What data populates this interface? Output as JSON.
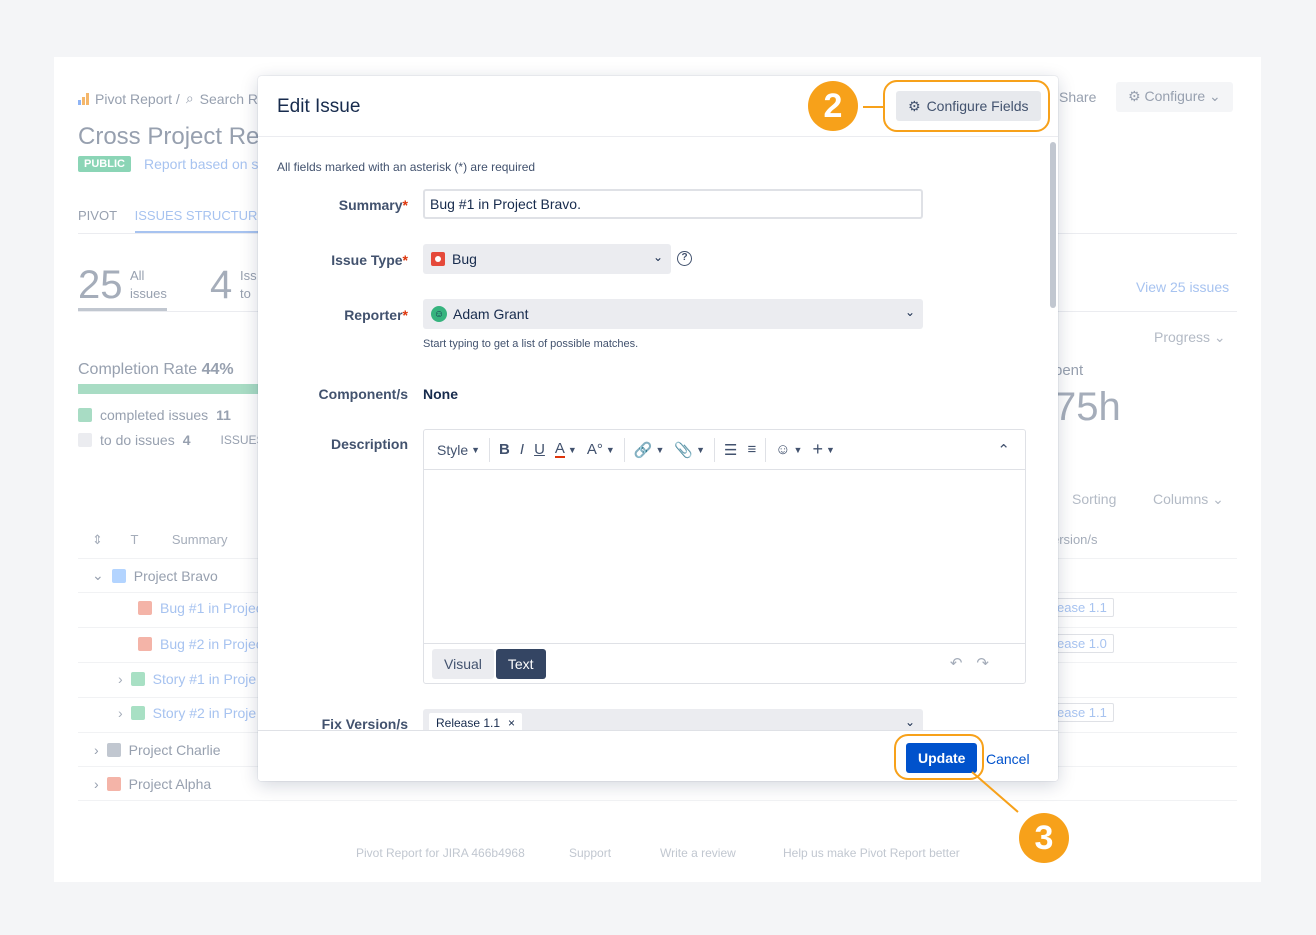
{
  "background": {
    "breadcrumb": {
      "pivot": "Pivot Report /",
      "search": "Search R"
    },
    "title": "Cross Project Rep",
    "badge": "PUBLIC",
    "subtitle": "Report based on se",
    "share": "Share",
    "configure": "Configure",
    "tabs": [
      "PIVOT",
      "ISSUES STRUCTURE"
    ],
    "stats": {
      "total": "25",
      "total_label1": "All",
      "total_label2": "issues",
      "second": "4",
      "second_label1": "Iss",
      "second_label2": "to"
    },
    "view_link": "View 25 issues",
    "progress": "Progress",
    "spent_label": "pent",
    "spent_value": "75h",
    "completion": {
      "label": "Completion Rate",
      "value": "44%",
      "completed_label": "completed issues",
      "completed_count": "11",
      "todo_label": "to do issues",
      "todo_count": "4",
      "issues_tag": "ISSUES"
    },
    "sorting": "Sorting",
    "columns": "Columns",
    "table_headers": {
      "t": "T",
      "summary": "Summary",
      "version": "ersion/s"
    },
    "rows": [
      {
        "label": "Project Bravo",
        "indent": 0,
        "expand": "v",
        "color": "#b3d4ff"
      },
      {
        "label": "Bug #1 in Projec",
        "indent": 2,
        "expand": "",
        "color": "#f4b4a8",
        "release": "ease 1.1"
      },
      {
        "label": "Bug #2 in Projec",
        "indent": 2,
        "expand": "",
        "color": "#f4b4a8",
        "release": "ease 1.0"
      },
      {
        "label": "Story #1 in Proje",
        "indent": 1,
        "expand": ">",
        "color": "#a8e0c4"
      },
      {
        "label": "Story #2 in Proje",
        "indent": 1,
        "expand": ">",
        "color": "#a8e0c4",
        "release": "ease 1.1"
      },
      {
        "label": "Project Charlie",
        "indent": 0,
        "expand": ">",
        "color": "#c1c7d0"
      },
      {
        "label": "Project Alpha",
        "indent": 0,
        "expand": ">",
        "color": "#f4b4a8"
      }
    ],
    "footer": [
      "Pivot Report for JIRA 466b4968",
      "Support",
      "Write a review",
      "Help us make Pivot Report better"
    ]
  },
  "modal": {
    "title": "Edit Issue",
    "configure_fields": "Configure Fields",
    "required_note": "All fields marked with an asterisk (*) are required",
    "summary": {
      "label": "Summary",
      "value": "Bug #1 in Project Bravo."
    },
    "issue_type": {
      "label": "Issue Type",
      "value": "Bug"
    },
    "reporter": {
      "label": "Reporter",
      "value": "Adam Grant",
      "hint": "Start typing to get a list of possible matches."
    },
    "components": {
      "label": "Component/s",
      "value": "None"
    },
    "description": {
      "label": "Description",
      "style_label": "Style",
      "mode_visual": "Visual",
      "mode_text": "Text"
    },
    "fix_version": {
      "label": "Fix Version/s",
      "chip": "Release 1.1"
    },
    "update": "Update",
    "cancel": "Cancel"
  },
  "callouts": [
    "2",
    "3"
  ],
  "colors": {
    "accent": "#f7a11a",
    "primary": "#0052cc"
  }
}
